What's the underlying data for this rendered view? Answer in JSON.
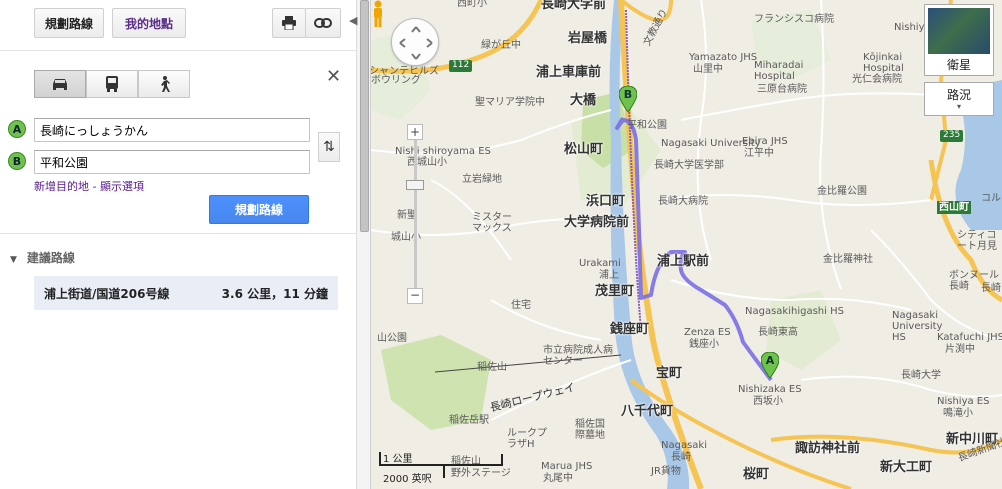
{
  "header": {
    "directions_label": "規劃路線",
    "mymaps_label": "我的地點"
  },
  "form": {
    "waypoint_a": {
      "marker": "A",
      "value": "長崎にっしょうかん"
    },
    "waypoint_b": {
      "marker": "B",
      "value": "平和公園"
    },
    "add_destination": "新增目的地",
    "separator": " - ",
    "show_options": "顯示選項",
    "submit_label": "規劃路線"
  },
  "results": {
    "section_title": "建議路線",
    "route": {
      "name": "浦上街道/国道206号線",
      "summary": "3.6 公里，11 分鐘"
    }
  },
  "map_controls": {
    "satellite_label": "衛星",
    "traffic_label": "路況"
  },
  "scale": {
    "metric": "1 公里",
    "imperial": "2000 英呎"
  },
  "map_labels": [
    "西町小",
    "長崎大学前",
    "岩屋橋",
    "文教通り",
    "浦上車庫前",
    "大橋",
    "松山町",
    "浜口町",
    "大学病院前",
    "浦上駅前",
    "茂里町",
    "銭座町",
    "宝町",
    "八千代町",
    "桜町",
    "諏訪神社前",
    "新大工町",
    "新中川町",
    "西山町",
    "聖マリア学院中",
    "Nishi shiroyama ES",
    "西城山小",
    "立岩緑地",
    "新聖",
    "城山小",
    "ミスターマックス",
    "Urakami",
    "浦上",
    "Nagasaki University",
    "長崎大学医学部",
    "長崎大病院",
    "Ebira JHS",
    "江平中",
    "金比羅公園",
    "金比羅神社",
    "Nagasakihigashi HS",
    "長崎東高",
    "Zenza ES",
    "銭座小",
    "Nishizaka ES",
    "西坂小",
    "市立病院成人病センター",
    "稲佐山",
    "稲佐岳駅",
    "長崎ロープウェイ",
    "ルークプラザH",
    "稲佐国際墓地",
    "Marua JHS",
    "丸尾中",
    "稲佐山",
    "野外ステージ",
    "Nagasaki",
    "長崎",
    "JR貨物",
    "Yamazato JHS",
    "山里中",
    "Miharadai Hospital",
    "三原台病院",
    "Kōjinkai Hospital",
    "光仁会病院",
    "Nishiya",
    "フランシスコ病院",
    "シティコート月見",
    "ボンヌール長崎",
    "Nagasaki University HS",
    "Katafuchi JHS",
    "片渕中",
    "長崎大学",
    "Nishiya ES",
    "鳴滝小",
    "長崎新聞社",
    "平和公園",
    "緑が丘中",
    "シャンテヒルズ",
    "ボウリング",
    "住宅",
    "山公園",
    "コルフ",
    "長崎"
  ],
  "route_shields": [
    "112",
    "235"
  ],
  "colors": {
    "route": "#7b6fe6",
    "marker_green": "#6fc24b",
    "primary_button": "#4d90fe",
    "park": "#c8dfa8",
    "water": "#a9c8e8",
    "highway": "#f6c453"
  }
}
